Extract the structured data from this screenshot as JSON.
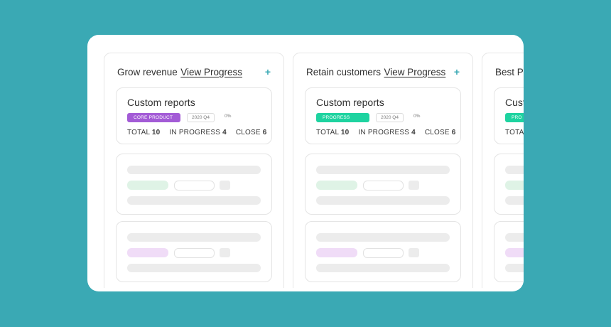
{
  "columns": [
    {
      "title": "Grow revenue",
      "link": "View Progress",
      "card": {
        "title": "Custom reports",
        "badge": "CORE PRODUCT",
        "badge_color": "#a35bd6",
        "period": "2020 Q4",
        "percent": "0%",
        "stats": {
          "total_label": "TOTAL",
          "total": "10",
          "in_progress_label": "IN PROGRESS",
          "in_progress": "4",
          "close_label": "CLOSE",
          "close": "6"
        }
      },
      "skeleton_color": "#dff3e6",
      "skeleton_color_2": "#f0dcf7"
    },
    {
      "title": "Retain customers",
      "link": "View Progress",
      "card": {
        "title": "Custom reports",
        "badge": "PROGRESS",
        "badge_color": "#1ed3a0",
        "period": "2020 Q4",
        "percent": "0%",
        "stats": {
          "total_label": "TOTAL",
          "total": "10",
          "in_progress_label": "IN PROGRESS",
          "in_progress": "4",
          "close_label": "CLOSE",
          "close": "6"
        }
      },
      "skeleton_color": "#dff3e6",
      "skeleton_color_2": "#f0dcf7"
    },
    {
      "title": "Best P",
      "card": {
        "title": "Cust",
        "badge": "PRO",
        "badge_color": "#1ed3a0",
        "stats": {
          "total_label": "TOTA"
        }
      },
      "skeleton_color": "#dff3e6",
      "skeleton_color_2": "#f0dcf7"
    }
  ],
  "colors": {
    "background": "#3aa9b4",
    "accent": "#3aa9b4",
    "panel": "#ffffff"
  },
  "icons": {
    "add": "plus-icon"
  }
}
